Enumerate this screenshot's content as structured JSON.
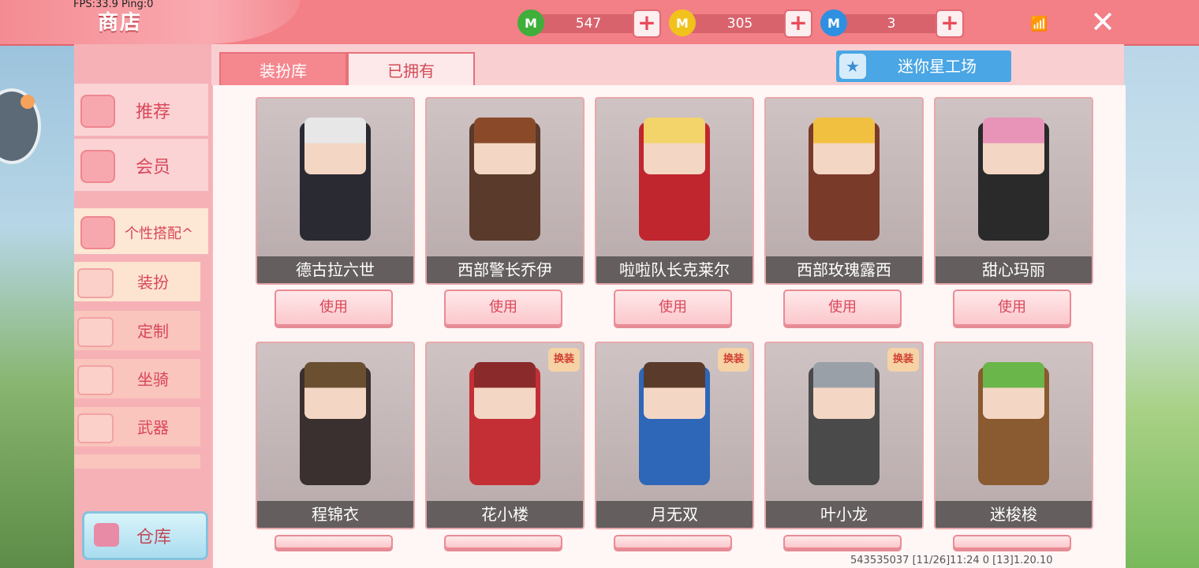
{
  "debug": {
    "fps": "FPS:33.9",
    "ping": "Ping:0"
  },
  "header": {
    "title": "商店",
    "close_icon": "close-icon"
  },
  "currencies": [
    {
      "icon": "green-coin-icon",
      "value": "547",
      "color": "#3fae3a"
    },
    {
      "icon": "gold-coin-icon",
      "value": "305",
      "color": "#f2c21c"
    },
    {
      "icon": "blue-coin-icon",
      "value": "3",
      "color": "#2f8fe0"
    }
  ],
  "sidebar": {
    "categories": [
      {
        "label": "推荐",
        "icon": "thumbs-up-icon"
      },
      {
        "label": "会员",
        "icon": "vip-icon"
      },
      {
        "label": "个性搭配^",
        "icon": "flower-icon"
      }
    ],
    "subcategories": [
      {
        "label": "装扮",
        "icon": "shirt-icon"
      },
      {
        "label": "定制",
        "icon": "pencil-icon"
      },
      {
        "label": "坐骑",
        "icon": "mount-icon"
      },
      {
        "label": "武器",
        "icon": "gun-icon"
      }
    ],
    "warehouse": {
      "label": "仓库",
      "icon": "chest-icon"
    }
  },
  "tabs": [
    "装扮库",
    "已拥有"
  ],
  "workshop": {
    "label": "迷你星工场",
    "icon": "star-icon"
  },
  "use_label": "使用",
  "skins": [
    {
      "name": "德古拉六世",
      "tag": "",
      "hair": "#e7e7e7",
      "outfit": "#2a2a33"
    },
    {
      "name": "西部警长乔伊",
      "tag": "",
      "hair": "#8a4a2a",
      "outfit": "#5a3a2a"
    },
    {
      "name": "啦啦队长克莱尔",
      "tag": "",
      "hair": "#f2d46a",
      "outfit": "#c0262e"
    },
    {
      "name": "西部玫瑰露西",
      "tag": "",
      "hair": "#f2c040",
      "outfit": "#7a3a2a"
    },
    {
      "name": "甜心玛丽",
      "tag": "",
      "hair": "#e893b8",
      "outfit": "#2a2a2a"
    },
    {
      "name": "程锦衣",
      "tag": "",
      "hair": "#6a5030",
      "outfit": "#3a3030"
    },
    {
      "name": "花小楼",
      "tag": "换装",
      "hair": "#8a2a2a",
      "outfit": "#c42f36"
    },
    {
      "name": "月无双",
      "tag": "换装",
      "hair": "#5a3a2a",
      "outfit": "#2e67b7"
    },
    {
      "name": "叶小龙",
      "tag": "换装",
      "hair": "#9aa0a8",
      "outfit": "#4a4a4a"
    },
    {
      "name": "迷梭梭",
      "tag": "",
      "hair": "#6bb64a",
      "outfit": "#8a5a30"
    }
  ],
  "footer": {
    "text": "543535037   [11/26]11:24 0    [13]1.20.10"
  }
}
